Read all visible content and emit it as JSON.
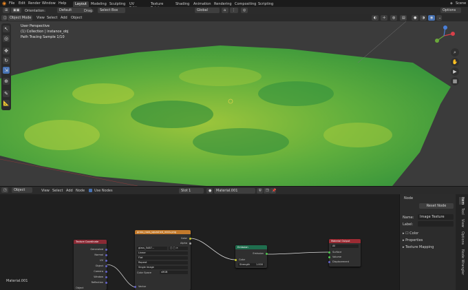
{
  "menubar": {
    "items": [
      "File",
      "Edit",
      "Render",
      "Window",
      "Help"
    ],
    "tabs": [
      "Layout",
      "Modeling",
      "Sculpting",
      "UV Editing",
      "Texture Paint",
      "Shading",
      "Animation",
      "Rendering",
      "Compositing",
      "Scripting"
    ],
    "active_tab": "Layout",
    "scene": "Scene"
  },
  "toolbar1": {
    "orientation_label": "Orientation:",
    "orientation_value": "Default",
    "drag_label": "Drag:",
    "drag_value": "Select Box",
    "transform": "Global",
    "options": "Options"
  },
  "toolbar2": {
    "mode": "Object Mode",
    "items": [
      "View",
      "Select",
      "Add",
      "Object"
    ]
  },
  "viewport": {
    "line1": "User Perspective",
    "line2": "(1) Collection | instance_obj",
    "line3": "Path Tracing Sample 1/10"
  },
  "node_header": {
    "type": "Object",
    "items": [
      "View",
      "Select",
      "Add",
      "Node"
    ],
    "use_nodes": "Use Nodes",
    "slot": "Slot 1",
    "material": "Material.001"
  },
  "node_editor": {
    "material_label": "Material.001",
    "texcoord": {
      "title": "Texture Coordinate",
      "outputs": [
        "Generated",
        "Normal",
        "UV",
        "Object",
        "Camera",
        "Window",
        "Reflection"
      ],
      "object_label": "Object"
    },
    "image_texture": {
      "title": "grass_rows_squashed_minis.png",
      "outputs": [
        "Color",
        "Alpha"
      ],
      "image_name": "glass_5A87...",
      "interpolation": "Linear",
      "projection": "Flat",
      "extension": "Repeat",
      "source": "Single Image",
      "color_space_label": "Color Space",
      "color_space": "sRGB",
      "input": "Vector"
    },
    "emission": {
      "title": "Emission",
      "output": "Emission",
      "inputs": [
        "Color"
      ],
      "strength_label": "Strength",
      "strength_value": "1.000"
    },
    "material_output": {
      "title": "Material Output",
      "target": "All",
      "inputs": [
        "Surface",
        "Volume",
        "Displacement"
      ]
    }
  },
  "sidepanel": {
    "section": "Node",
    "reset_node": "Reset Node",
    "name_label": "Name:",
    "name_value": "Image Texture",
    "label_label": "Label:",
    "label_value": "",
    "color": "Color",
    "properties": "Properties",
    "texture_mapping": "Texture Mapping",
    "tabs": [
      "Item",
      "Tool",
      "View",
      "Options",
      "Node Wrangler"
    ]
  },
  "colors": {
    "accent": "#4772b3",
    "grass_light": "#a6c934",
    "grass_dark": "#1f7a36",
    "texcoord_header": "#8a2a35",
    "texture_header": "#c27a2c",
    "emission_header": "#1f6e4e",
    "output_header": "#9a2b33"
  }
}
